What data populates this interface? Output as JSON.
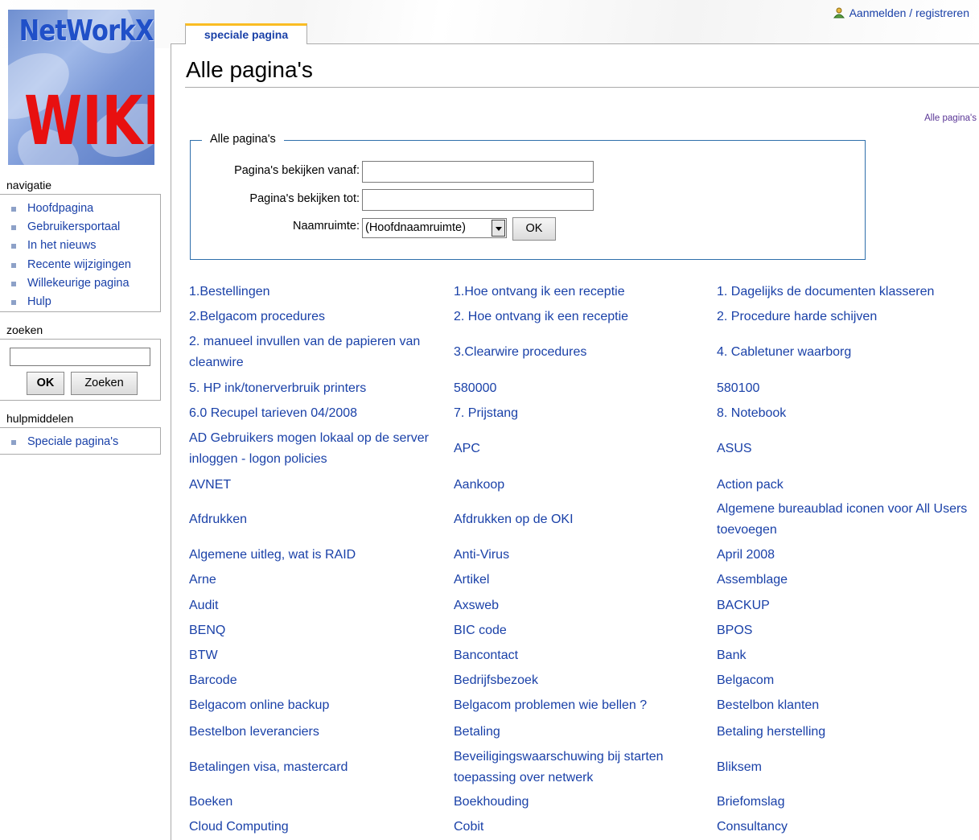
{
  "logo": {
    "title": "NetWorkX",
    "subtitle": "WIKI"
  },
  "user_link": "Aanmelden / registreren",
  "sidebar": {
    "navigation_title": "navigatie",
    "navigation_items": [
      "Hoofdpagina",
      "Gebruikersportaal",
      "In het nieuws",
      "Recente wijzigingen",
      "Willekeurige pagina",
      "Hulp"
    ],
    "search_title": "zoeken",
    "search_ok": "OK",
    "search_button": "Zoeken",
    "tools_title": "hulpmiddelen",
    "tools_items": [
      "Speciale pagina's"
    ]
  },
  "tab": {
    "label": "speciale pagina"
  },
  "page": {
    "title": "Alle pagina's",
    "right_link": "Alle pagina's"
  },
  "form": {
    "legend": "Alle pagina's",
    "from_label": "Pagina's bekijken vanaf:",
    "to_label": "Pagina's bekijken tot:",
    "namespace_label": "Naamruimte:",
    "namespace_value": "(Hoofdnaamruimte)",
    "ok_label": "OK"
  },
  "pages": [
    [
      "1.Bestellingen",
      "1.Hoe ontvang ik een receptie",
      "1. Dagelijks de documenten klasseren"
    ],
    [
      "2.Belgacom procedures",
      "2. Hoe ontvang ik een receptie",
      "2. Procedure harde schijven"
    ],
    [
      "2. manueel invullen van de papieren van cleanwire",
      "3.Clearwire procedures",
      "4. Cabletuner waarborg"
    ],
    [
      "5. HP ink/tonerverbruik printers",
      "580000",
      "580100"
    ],
    [
      "6.0 Recupel tarieven 04/2008",
      "7. Prijstang",
      "8. Notebook"
    ],
    [
      "AD Gebruikers mogen lokaal op de server inloggen - logon policies",
      "APC",
      "ASUS"
    ],
    [
      "AVNET",
      "Aankoop",
      "Action pack"
    ],
    [
      "Afdrukken",
      "Afdrukken op de OKI",
      "Algemene bureaublad iconen voor All Users toevoegen"
    ],
    [
      "Algemene uitleg, wat is RAID",
      "Anti-Virus",
      "April 2008"
    ],
    [
      "Arne",
      "Artikel",
      "Assemblage"
    ],
    [
      "Audit",
      "Axsweb",
      "BACKUP"
    ],
    [
      "BENQ",
      "BIC code",
      "BPOS"
    ],
    [
      "BTW",
      "Bancontact",
      "Bank"
    ],
    [
      "Barcode",
      "Bedrijfsbezoek",
      "Belgacom"
    ],
    [
      "Belgacom online backup",
      "Belgacom problemen wie bellen ?",
      "Bestelbon klanten"
    ],
    [
      "Bestelbon leveranciers",
      "Betaling",
      "Betaling herstelling"
    ],
    [
      "Betalingen visa, mastercard",
      "Beveiligingswaarschuwing bij starten toepassing over netwerk",
      "Bliksem"
    ],
    [
      "Boeken",
      "Boekhouding",
      "Briefomslag"
    ],
    [
      "Cloud Computing",
      "Cobit",
      "Consultancy"
    ]
  ]
}
